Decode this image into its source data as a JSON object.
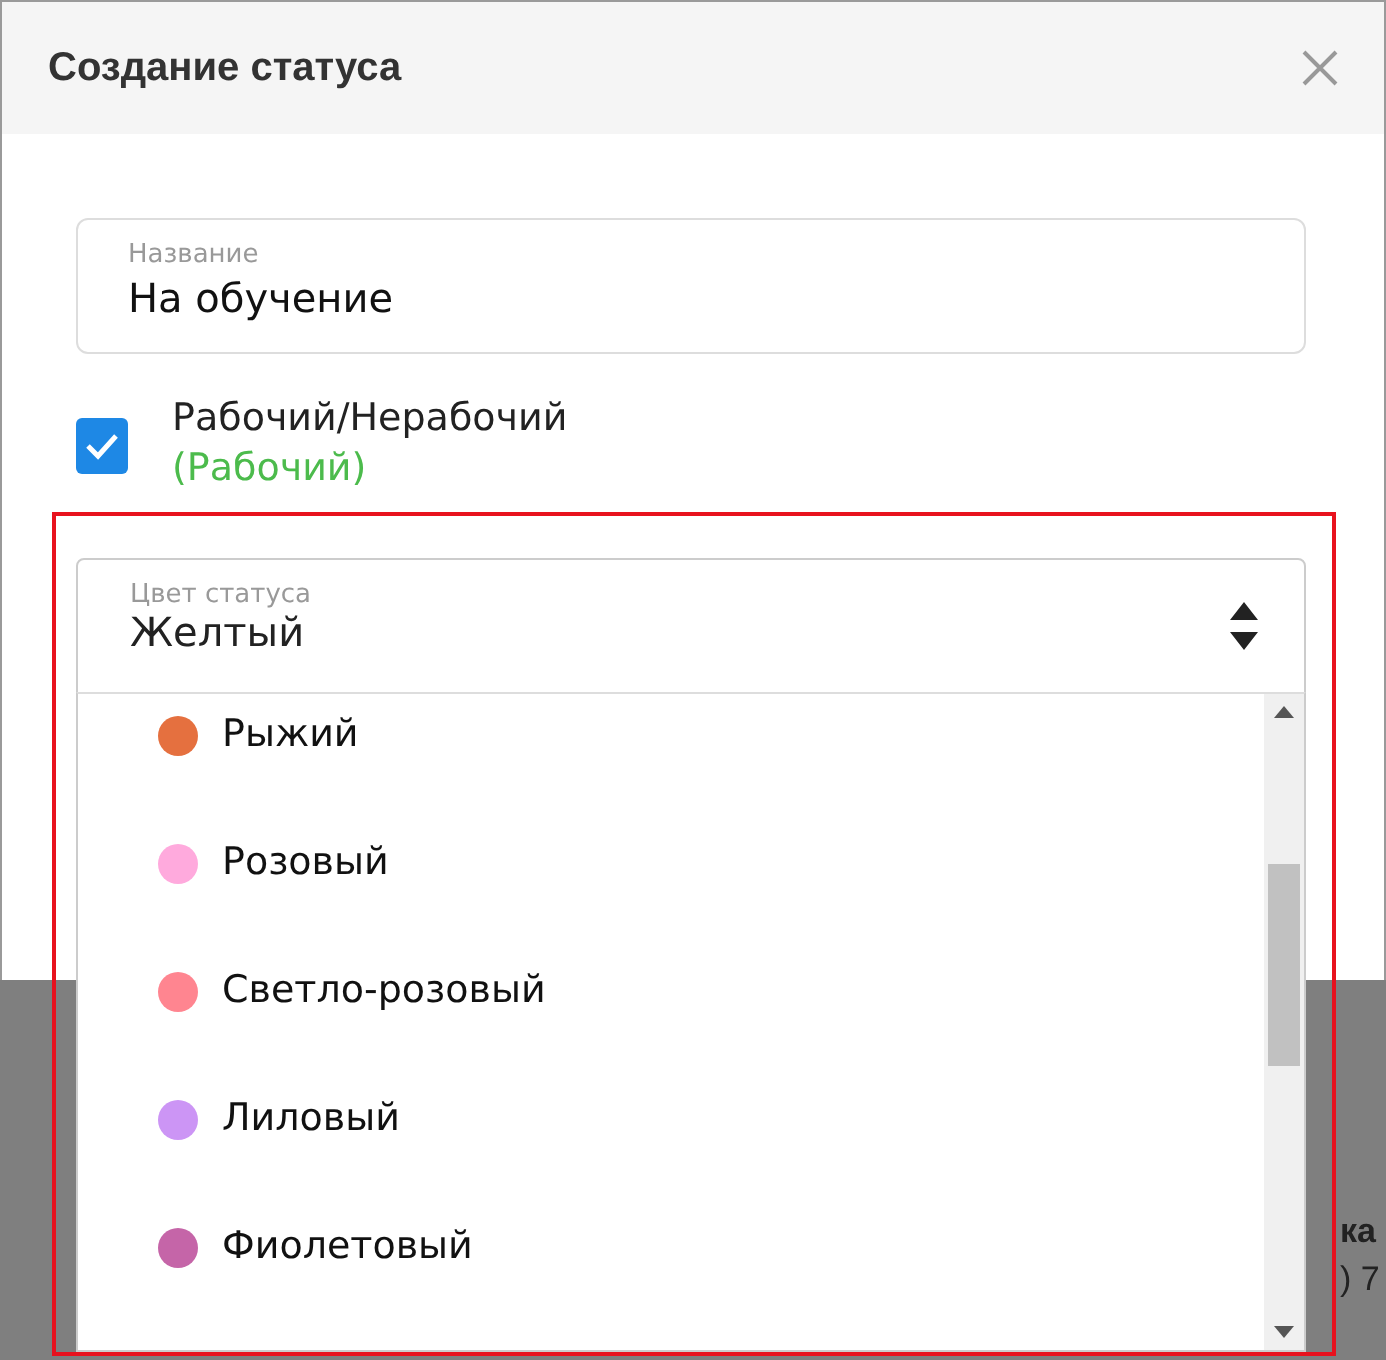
{
  "dialog": {
    "title": "Создание статуса"
  },
  "name_field": {
    "label": "Название",
    "value": "На обучение"
  },
  "working_checkbox": {
    "label": "Рабочий/Нерабочий",
    "state_text": "(Рабочий)",
    "checked": true
  },
  "color_select": {
    "label": "Цвет статуса",
    "value": "Желтый",
    "expanded": true,
    "options": [
      {
        "label": "Рыжий",
        "color": "#e5703f"
      },
      {
        "label": "Розовый",
        "color": "#ffaadd"
      },
      {
        "label": "Светло-розовый",
        "color": "#ff8590"
      },
      {
        "label": "Лиловый",
        "color": "#cc95f5"
      },
      {
        "label": "Фиолетовый",
        "color": "#c565a8"
      }
    ]
  },
  "background_text": [
    {
      "text": "ка",
      "bold": true
    },
    {
      "text": ") 7",
      "bold": false
    }
  ]
}
